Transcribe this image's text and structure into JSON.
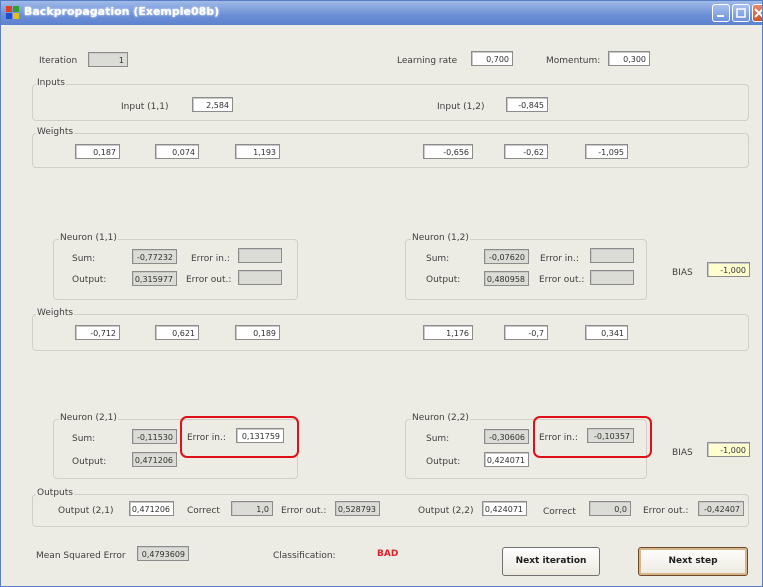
{
  "window": {
    "title": "Backpropagation (Exemple08b)"
  },
  "top": {
    "iteration_label": "Iteration",
    "iteration": "1",
    "learning_rate_label": "Learning rate",
    "learning_rate": "0,700",
    "momentum_label": "Momentum:",
    "momentum": "0,300"
  },
  "inputs": {
    "group_label": "Inputs",
    "input_1_1_label": "Input (1,1)",
    "input_1_1": "2,584",
    "input_1_2_label": "Input (1,2)",
    "input_1_2": "-0,845"
  },
  "weights1": {
    "group_label": "Weights",
    "values": [
      "0,187",
      "0,074",
      "1,193",
      "-0,656",
      "-0,62",
      "-1,095"
    ]
  },
  "neuron_1_1": {
    "label": "Neuron (1,1)",
    "sum_label": "Sum:",
    "sum": "-0,77232",
    "output_label": "Output:",
    "output": "0,315977",
    "error_in_label": "Error in.:",
    "error_in": "",
    "error_out_label": "Error out.:",
    "error_out": ""
  },
  "neuron_1_2": {
    "label": "Neuron (1,2)",
    "sum_label": "Sum:",
    "sum": "-0,07620",
    "output_label": "Output:",
    "output": "0,480958",
    "error_in_label": "Error in.:",
    "error_in": "",
    "error_out_label": "Error out.:",
    "error_out": ""
  },
  "bias1": {
    "label": "BIAS",
    "value": "-1,000"
  },
  "weights2": {
    "group_label": "Weights",
    "values": [
      "-0,712",
      "0,621",
      "0,189",
      "1,176",
      "-0,7",
      "0,341"
    ]
  },
  "neuron_2_1": {
    "label": "Neuron (2,1)",
    "sum_label": "Sum:",
    "sum": "-0,11530",
    "output_label": "Output:",
    "output": "0,471206",
    "error_in_label": "Error in.:",
    "error_in": "0,131759"
  },
  "neuron_2_2": {
    "label": "Neuron (2,2)",
    "sum_label": "Sum:",
    "sum": "-0,30606",
    "output_label": "Output:",
    "output": "0,424071",
    "error_in_label": "Error in.:",
    "error_in": "-0,10357"
  },
  "bias2": {
    "label": "BIAS",
    "value": "-1,000"
  },
  "outputs": {
    "group_label": "Outputs",
    "output_2_1_label": "Output (2,1)",
    "output_2_1": "0,471206",
    "correct_1_label": "Correct",
    "correct_1": "1,0",
    "error_out_1_label": "Error out.:",
    "error_out_1": "0,528793",
    "output_2_2_label": "Output (2,2)",
    "output_2_2": "0,424071",
    "correct_2_label": "Correct",
    "correct_2": "0,0",
    "error_out_2_label": "Error out.:",
    "error_out_2": "-0,42407"
  },
  "footer": {
    "mse_label": "Mean Squared Error",
    "mse": "0,4793609",
    "classification_label": "Classification:",
    "classification": "BAD",
    "next_iteration": "Next iteration",
    "next_step": "Next step"
  },
  "colors": {
    "highlight": "#e0101a",
    "titlebar": "#6b8fd6",
    "bias_field": "#ffffd0"
  }
}
